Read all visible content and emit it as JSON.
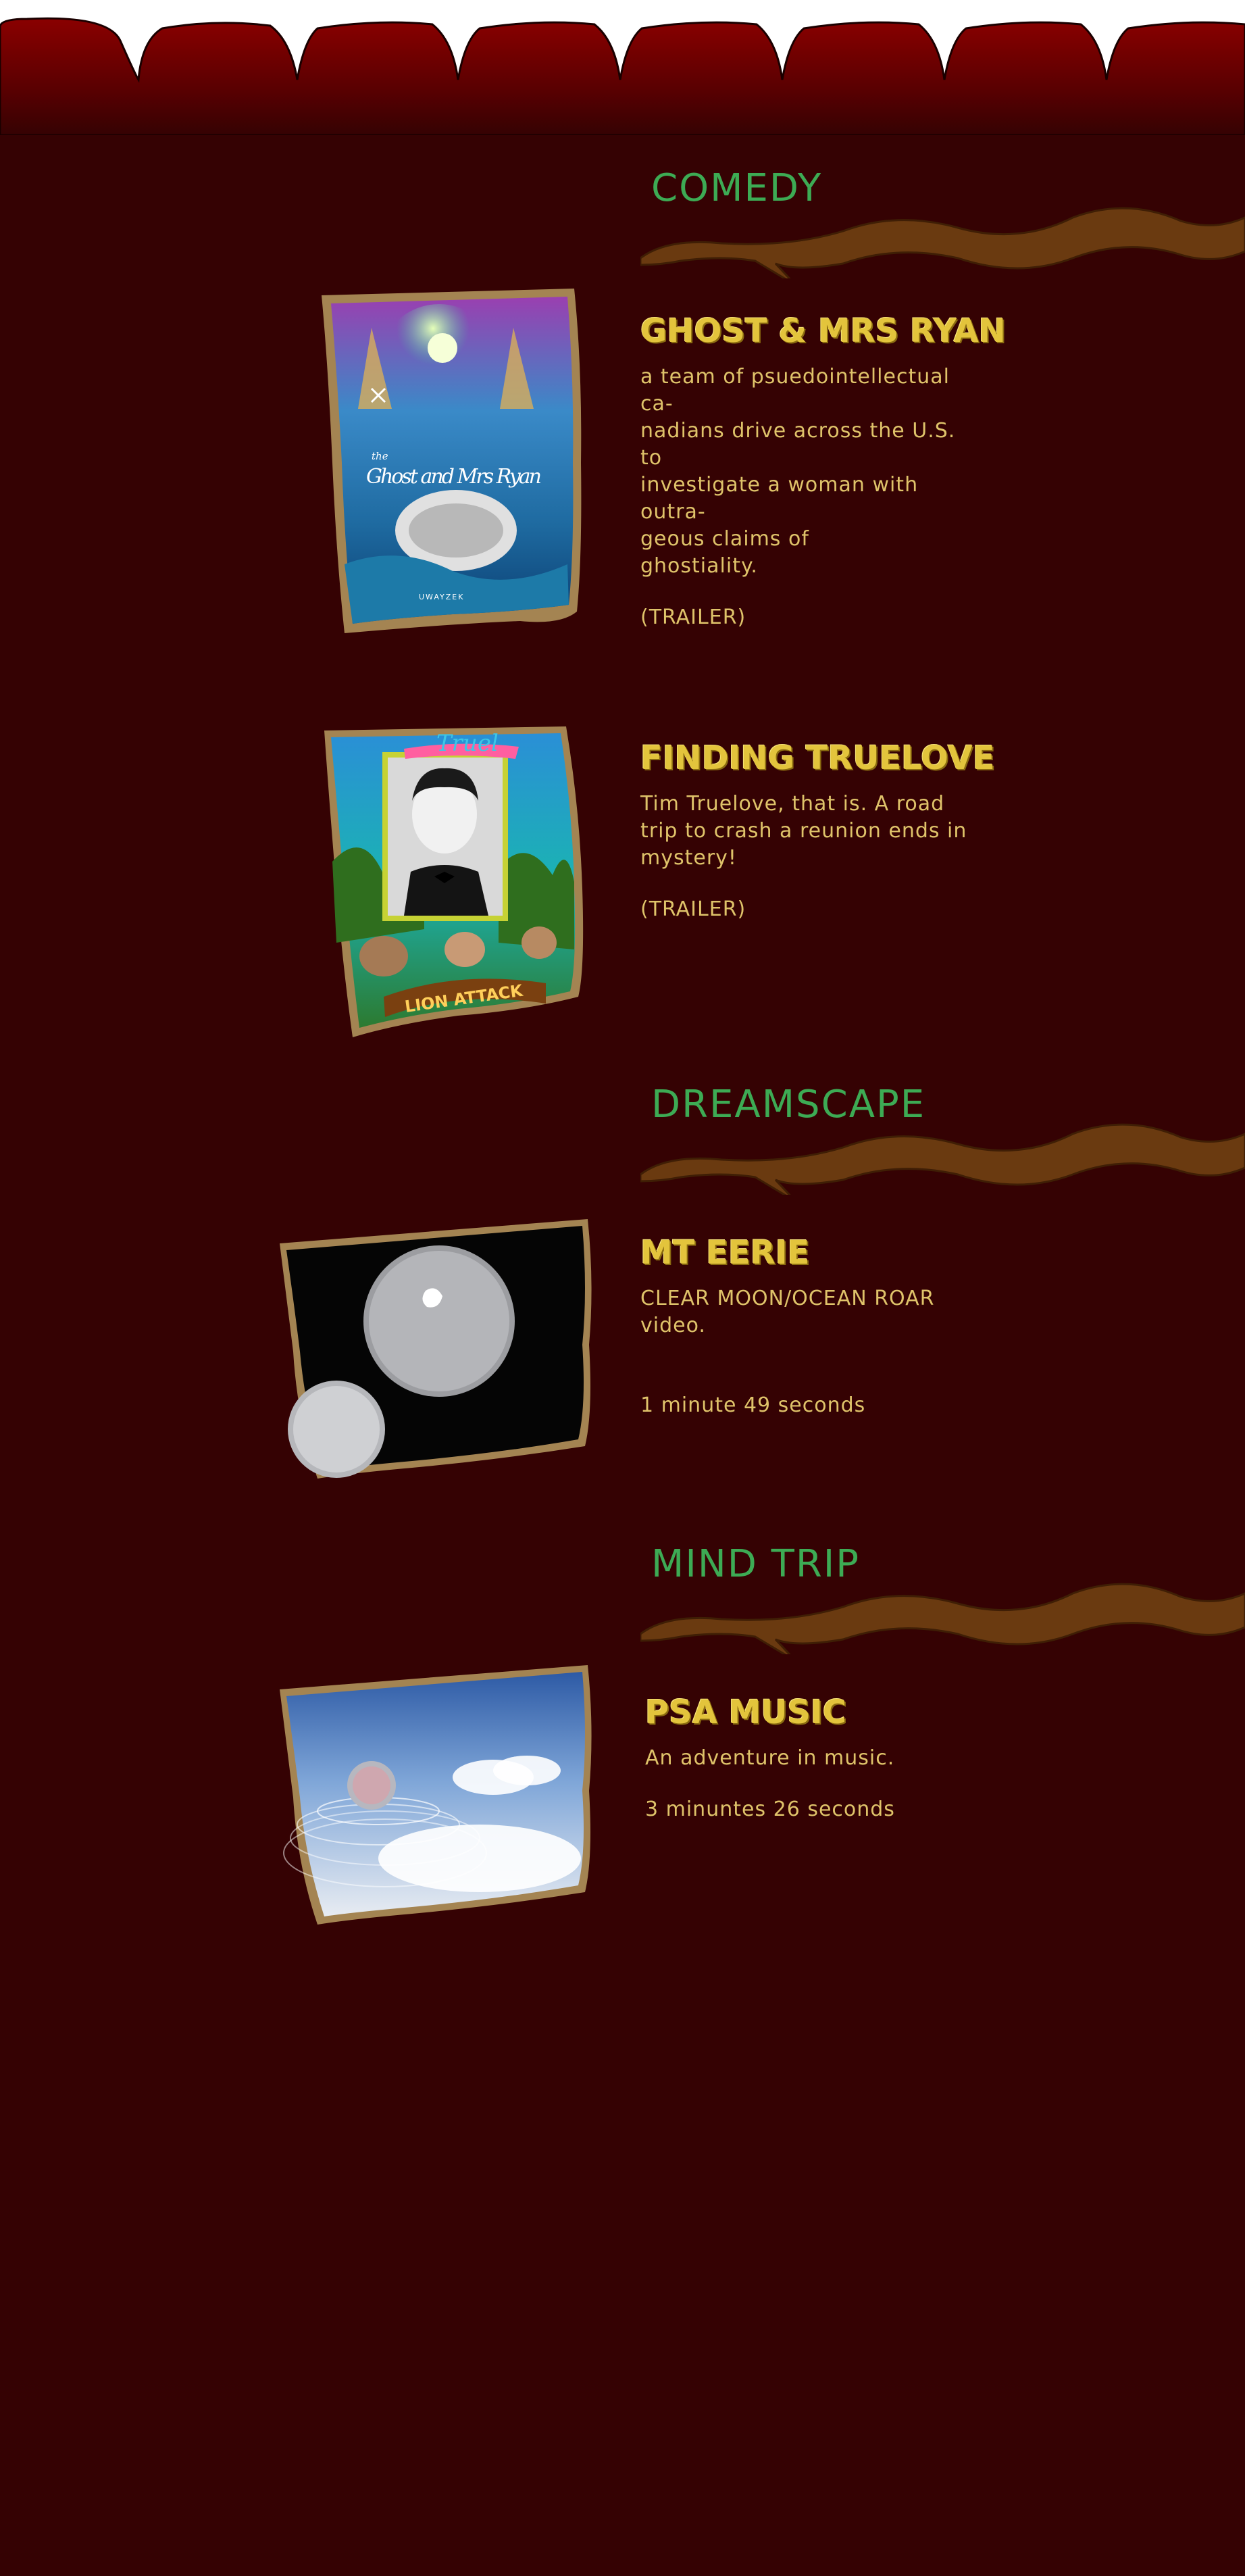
{
  "colors": {
    "background": "#350203",
    "curtain": "#7a0000",
    "section_heading": "#3dab54",
    "item_title": "#e3c43c",
    "item_text": "#dfc36a",
    "branch": "#6a3a10"
  },
  "sections": [
    {
      "title": "COMEDY",
      "items": [
        {
          "title": "GHOST & MRS RYAN",
          "description": "a team of psuedointellectual ca-\nnadians drive across the U.S. to\ninvestigate a woman with outra-\ngeous claims of\nghostiality.",
          "link": "(TRAILER)",
          "poster": {
            "script_title": "Ghost and Mrs Ryan",
            "the": "the",
            "credit": "UWAYZEK"
          }
        },
        {
          "title": "FINDING TRUELOVE",
          "description": "Tim Truelove, that is.  A road\ntrip to crash a reunion ends in\nmystery!",
          "link": "(TRAILER)",
          "poster": {
            "top_text": "Truel",
            "banner_text": "LION ATTACK"
          }
        }
      ]
    },
    {
      "title": "DREAMSCAPE",
      "items": [
        {
          "title": "MT EERIE",
          "description": "CLEAR MOON/OCEAN ROAR\nvideo.",
          "duration": "1 minute 49 seconds"
        }
      ]
    },
    {
      "title": "MIND TRIP",
      "items": [
        {
          "title": "PSA MUSIC",
          "description": "An adventure in music.",
          "duration": "3 minuntes 26 seconds"
        }
      ]
    }
  ]
}
